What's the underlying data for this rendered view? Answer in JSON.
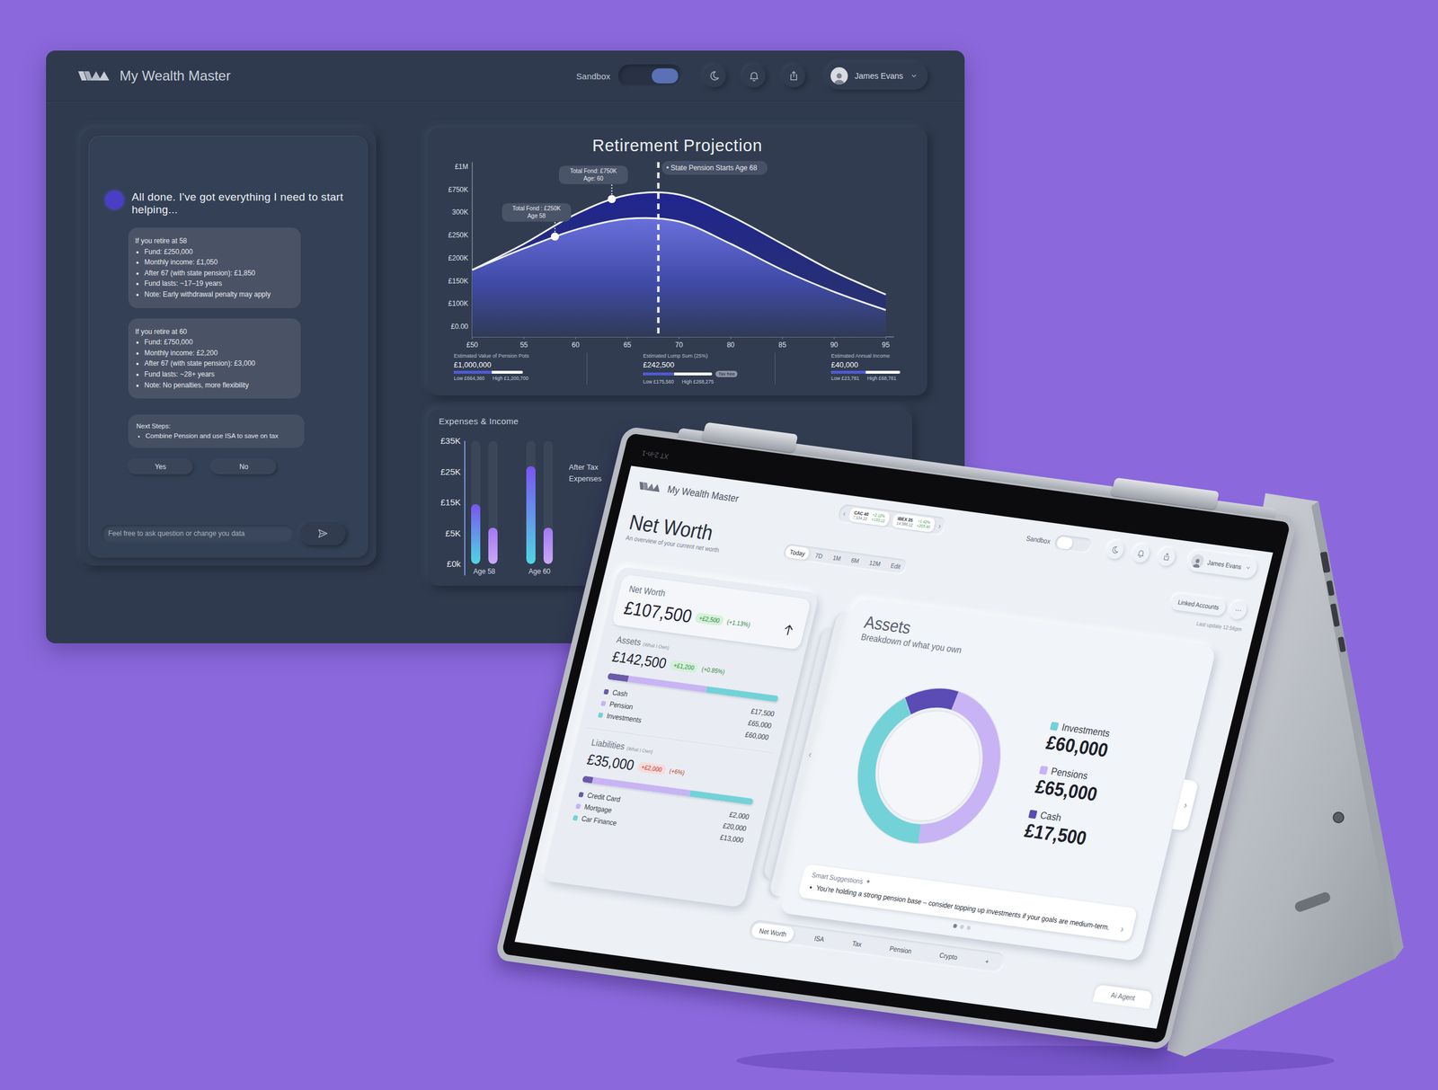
{
  "dashboard": {
    "brand": "My Wealth Master",
    "sandbox": {
      "label": "Sandbox",
      "on": true
    },
    "user": "James Evans",
    "chat": {
      "message": "All done. I've got everything I need to start helping...",
      "scenarios": [
        {
          "title": "If you retire at 58",
          "items": [
            "Fund: £250,000",
            "Monthly income: £1,050",
            "After 67 (with state pension): £1,850",
            "Fund lasts: ~17–19 years",
            "Note: Early withdrawal penalty may apply"
          ]
        },
        {
          "title": "If you retire at 60",
          "items": [
            "Fund: £750,000",
            "Monthly income: £2,200",
            "After 67 (with state pension): £3,000",
            "Fund lasts: ~28+ years",
            "Note: No penalties, more flexibility"
          ]
        }
      ],
      "next_steps": {
        "title": "Next Steps:",
        "items": [
          "Combine Pension and use ISA to save on tax"
        ]
      },
      "buttons": [
        "Yes",
        "No"
      ],
      "input_placeholder": "Feel free to ask question or change you data"
    },
    "projection": {
      "title": "Retirement Projection",
      "y_ticks": [
        {
          "label": "£1M",
          "value": 1000
        },
        {
          "label": "£750K",
          "value": 750
        },
        {
          "label": "300K",
          "value": 300
        },
        {
          "label": "£250K",
          "value": 250
        },
        {
          "label": "£200K",
          "value": 200
        },
        {
          "label": "£150K",
          "value": 150
        },
        {
          "label": "£100K",
          "value": 100
        },
        {
          "label": "£0.00",
          "value": 0
        }
      ],
      "x_ticks": [
        {
          "label": "£50",
          "value": 50
        },
        {
          "label": "55",
          "value": 55
        },
        {
          "label": "60",
          "value": 60
        },
        {
          "label": "65",
          "value": 65
        },
        {
          "label": "70",
          "value": 70
        },
        {
          "label": "80",
          "value": 80
        },
        {
          "label": "85",
          "value": 85
        },
        {
          "label": "90",
          "value": 90
        },
        {
          "label": "95",
          "value": 95
        }
      ],
      "series": [
        {
          "values": [
            174,
            231,
            296,
            642,
            650,
            292,
            231,
            170,
            120
          ]
        },
        {
          "values": [
            174,
            221,
            262,
            286,
            280,
            231,
            174,
            126,
            72
          ]
        }
      ],
      "markers": [
        {
          "series": 1,
          "age": 58,
          "label": "Total Fond : £250K",
          "sub": "Age 58"
        },
        {
          "series": 0,
          "age": 63.5,
          "label": "Total Fond: £750K",
          "sub": "Age: 60"
        }
      ],
      "pension_line": {
        "age": 68,
        "label": "• State Pension Starts Age 68"
      },
      "stats": [
        {
          "label": "Estimated Value of Pension Pots",
          "value": "£1,000,000",
          "level": 0.55,
          "low": "Low £664,360",
          "high": "High £1,200,700"
        },
        {
          "label": "Estimated Lump Sum (25%)",
          "value": "£242,500",
          "badge": "Tax free",
          "level": 0.45,
          "low": "Low £175,560",
          "high": "High £268,275"
        },
        {
          "label": "Estimated Annual Income",
          "value": "£40,000",
          "level": 0.5,
          "low": "Low £23,781",
          "high": "High £68,781"
        }
      ]
    },
    "expenses": {
      "title": "Expenses & Income",
      "y_ticks": [
        {
          "label": "£35K",
          "value": 35
        },
        {
          "label": "£25K",
          "value": 25
        },
        {
          "label": "£15K",
          "value": 15
        },
        {
          "label": "£5K",
          "value": 5
        },
        {
          "label": "£0k",
          "value": 0
        }
      ],
      "groups": [
        {
          "label": "Age 58",
          "bars": [
            {
              "value": 14.4,
              "kind": "income"
            },
            {
              "value": 6.8,
              "kind": "expense"
            }
          ]
        },
        {
          "label": "Age 60",
          "bars": [
            {
              "value": 26.8,
              "kind": "income"
            },
            {
              "value": 6.8,
              "kind": "expense"
            }
          ]
        }
      ],
      "legend": [
        "After Tax",
        "Expenses"
      ]
    }
  },
  "tablet": {
    "bezel_label": "XT 2-in-1",
    "brand": "My Wealth Master",
    "ticker_prev": "‹",
    "ticker_next": "›",
    "tickers": [
      {
        "name": "CAC 40",
        "value": "7,534.22",
        "change": "+2.12%",
        "delta": "+133.12"
      },
      {
        "name": "IBEX 35",
        "value": "14,386.12",
        "change": "+1.42%",
        "delta": "+203.40"
      }
    ],
    "sandbox": {
      "label": "Sandbox",
      "on": false
    },
    "user": "James Evans",
    "title": "Net Worth",
    "subtitle": "An overview of your current net worth",
    "periods": [
      {
        "label": "Today",
        "selected": true
      },
      {
        "label": "7D",
        "selected": false
      },
      {
        "label": "1M",
        "selected": false
      },
      {
        "label": "6M",
        "selected": false
      },
      {
        "label": "12M",
        "selected": false
      },
      {
        "label": "Edit",
        "selected": false
      }
    ],
    "linked_accounts": "Linked Accounts",
    "more": "···",
    "last_update": "Last update 12:56pm",
    "summary": {
      "net_worth": {
        "label": "Net Worth",
        "value": "£107,500",
        "change": "+£2,500",
        "percent": "(+1.13%)",
        "tone": "positive",
        "trend": "up"
      },
      "assets": {
        "label": "Assets",
        "note": "(What I Own)",
        "value": "£142,500",
        "change": "+£1,200",
        "percent": "(+0.85%)",
        "tone": "positive",
        "items": [
          {
            "name": "Cash",
            "value": "£17,500",
            "level": 0.12,
            "color": "#6a5aa8"
          },
          {
            "name": "Pension",
            "value": "£65,000",
            "level": 0.46,
            "color": "#c8b3f5"
          },
          {
            "name": "Investments",
            "value": "£60,000",
            "level": 0.42,
            "color": "#72d2d8"
          }
        ]
      },
      "liabilities": {
        "label": "Liabilities",
        "note": "(What I Own)",
        "value": "£35,000",
        "change": "+£2,000",
        "percent": "(+6%)",
        "tone": "negative",
        "items": [
          {
            "name": "Credit Card",
            "value": "£2,000",
            "level": 0.06,
            "color": "#6a5aa8"
          },
          {
            "name": "Mortgage",
            "value": "£20,000",
            "level": 0.57,
            "color": "#c8b3f5"
          },
          {
            "name": "Car Finance",
            "value": "£13,000",
            "level": 0.37,
            "color": "#72d2d8"
          }
        ]
      }
    },
    "assets_card": {
      "title": "Assets",
      "subtitle": "Breakdown of what you own",
      "items": [
        {
          "name": "Investments",
          "value": "£60,000",
          "level": 0.42,
          "color": "#72d2d8"
        },
        {
          "name": "Pensions",
          "value": "£65,000",
          "level": 0.456,
          "color": "#c8b3f5"
        },
        {
          "name": "Cash",
          "value": "£17,500",
          "level": 0.123,
          "color": "#5a4bb5"
        }
      ],
      "prev": "‹",
      "next": "›",
      "suggestions": {
        "title": "Smart Suggestions",
        "icon": "✦",
        "items": [
          "You're holding a strong pension base – consider topping up investments if your goals are medium-term."
        ],
        "next": "›",
        "pages": [
          {
            "selected": true
          },
          {
            "selected": false
          },
          {
            "selected": false
          }
        ]
      }
    },
    "tabs": [
      {
        "label": "Net Worth",
        "selected": true
      },
      {
        "label": "ISA",
        "selected": false
      },
      {
        "label": "Tax",
        "selected": false
      },
      {
        "label": "Pension",
        "selected": false
      },
      {
        "label": "Crypto",
        "selected": false
      },
      {
        "label": "+",
        "selected": false
      }
    ],
    "ai_agent": "Ai Agent"
  }
}
